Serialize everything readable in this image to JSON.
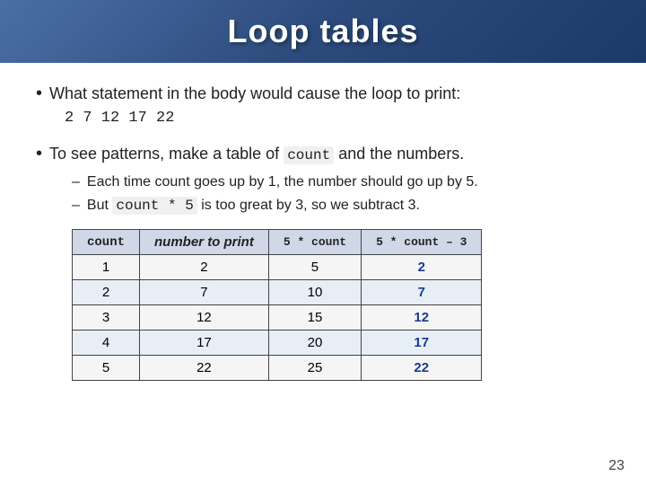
{
  "header": {
    "title": "Loop tables"
  },
  "bullet1": {
    "prefix": "What statement in the body would cause the loop to print:",
    "code": "2  7  12  17  22"
  },
  "bullet2": {
    "prefix": "To see patterns, make a table of",
    "code_inline": "count",
    "suffix": "and the numbers."
  },
  "subbullets": [
    {
      "text": "Each time count goes up by 1, the number should go up by 5."
    },
    {
      "prefix": "But",
      "code": "count * 5",
      "suffix": "is too great by 3, so we subtract 3."
    }
  ],
  "table": {
    "headers": [
      "count",
      "number to print",
      "5 * count",
      "5 * count – 3"
    ],
    "rows": [
      [
        "1",
        "2",
        "5",
        "2"
      ],
      [
        "2",
        "7",
        "10",
        "7"
      ],
      [
        "3",
        "12",
        "15",
        "12"
      ],
      [
        "4",
        "17",
        "20",
        "17"
      ],
      [
        "5",
        "22",
        "25",
        "22"
      ]
    ]
  },
  "page_number": "23"
}
